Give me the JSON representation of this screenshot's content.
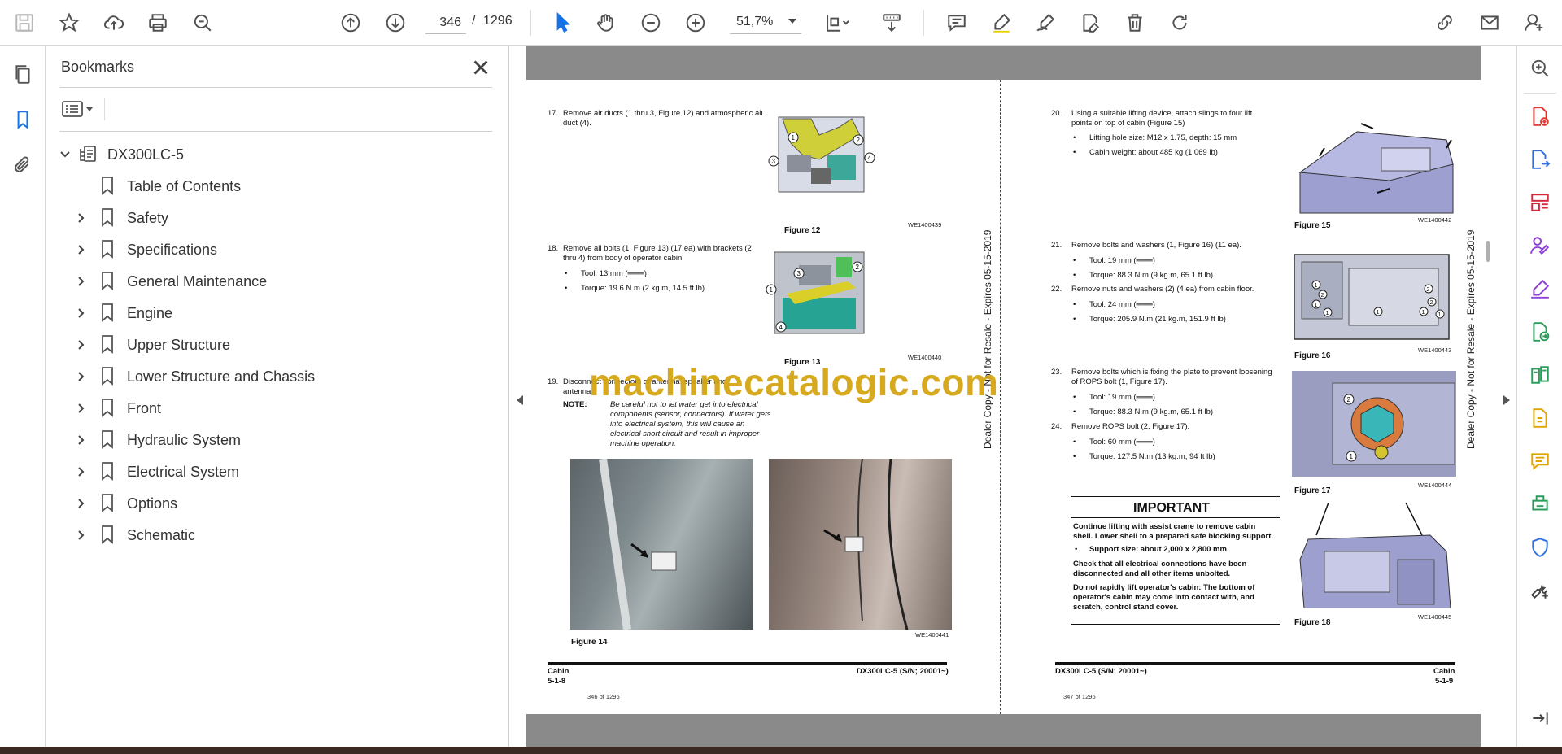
{
  "toolbar": {
    "page_current": "346",
    "page_separator": "/",
    "page_total": "1296",
    "zoom": "51,7%"
  },
  "bookmarks": {
    "title": "Bookmarks",
    "root": "DX300LC-5",
    "items": [
      {
        "label": "Table of Contents",
        "expandable": false
      },
      {
        "label": "Safety",
        "expandable": true
      },
      {
        "label": "Specifications",
        "expandable": true
      },
      {
        "label": "General Maintenance",
        "expandable": true
      },
      {
        "label": "Engine",
        "expandable": true
      },
      {
        "label": "Upper Structure",
        "expandable": true
      },
      {
        "label": "Lower Structure and Chassis",
        "expandable": true
      },
      {
        "label": "Front",
        "expandable": true
      },
      {
        "label": "Hydraulic System",
        "expandable": true
      },
      {
        "label": "Electrical System",
        "expandable": true
      },
      {
        "label": "Options",
        "expandable": true
      },
      {
        "label": "Schematic",
        "expandable": true
      }
    ]
  },
  "watermark": "machinecatalogic.com",
  "dealer_text": "Dealer Copy - Not for Resale - Expires 05-15-2019",
  "left_page": {
    "step17_num": "17.",
    "step17_l1": "Remove air ducts (1 thru 3, Figure 12) and atmospheric air",
    "step17_l2": "duct (4).",
    "fig12_cap": "Figure 12",
    "fig12_code": "WE1400439",
    "step18_num": "18.",
    "step18_l1": "Remove all bolts (1, Figure 13) (17 ea) with brackets (2",
    "step18_l2": "thru 4) from body of operator cabin.",
    "step18_tool": "Tool: 13 mm (═══)",
    "step18_torque": "Torque: 19.6 N.m (2 kg.m, 14.5 ft lb)",
    "fig13_cap": "Figure 13",
    "fig13_code": "WE1400440",
    "step19_num": "19.",
    "step19_l1": "Disconnect connectors of antenna, speaker and",
    "step19_l2": "antenna.",
    "note_label": "NOTE:",
    "note_l1": "Be careful not to let water get into electrical",
    "note_l2": "components (sensor, connectors). If water gets",
    "note_l3": "into electrical system, this will cause an",
    "note_l4": "electrical short circuit and result in improper",
    "note_l5": "machine operation.",
    "fig14_cap": "Figure 14",
    "fig14_code": "WE1400441",
    "footer_left1": "Cabin",
    "footer_left2": "5-1-8",
    "footer_right": "DX300LC-5 (S/N; 20001~)",
    "footer_pages": "346 of 1296"
  },
  "right_page": {
    "step20_num": "20.",
    "step20_l1": "Using a suitable lifting device, attach slings to four lift",
    "step20_l2": "points on top of cabin (Figure 15)",
    "step20_b1": "Lifting hole size: M12 x 1.75, depth: 15 mm",
    "step20_b2": "Cabin weight: about 485 kg (1,069 lb)",
    "fig15_cap": "Figure 15",
    "fig15_code": "WE1400442",
    "step21_num": "21.",
    "step21_l1": "Remove bolts and washers (1, Figure 16) (11 ea).",
    "step21_tool": "Tool: 19 mm (═══)",
    "step21_torque": "Torque: 88.3 N.m (9 kg.m, 65.1 ft lb)",
    "step22_num": "22.",
    "step22_l1": "Remove nuts and washers (2) (4 ea) from cabin floor.",
    "step22_tool": "Tool: 24 mm (═══)",
    "step22_torque": "Torque: 205.9 N.m (21 kg.m, 151.9 ft lb)",
    "fig16_cap": "Figure 16",
    "fig16_code": "WE1400443",
    "step23_num": "23.",
    "step23_l1": "Remove bolts which is fixing the plate to prevent loosening",
    "step23_l2": "of ROPS bolt (1, Figure 17).",
    "step23_tool": "Tool: 19 mm (═══)",
    "step23_torque": "Torque: 88.3 N.m (9 kg.m, 65.1 ft lb)",
    "step24_num": "24.",
    "step24_l1": "Remove ROPS bolt (2, Figure 17).",
    "step24_tool": "Tool: 60 mm (═══)",
    "step24_torque": "Torque: 127.5 N.m (13 kg.m, 94 ft lb)",
    "fig17_cap": "Figure 17",
    "fig17_code": "WE1400444",
    "important_title": "IMPORTANT",
    "imp_l1": "Continue lifting with assist crane to remove cabin",
    "imp_l2": "shell. Lower shell to a prepared safe blocking support.",
    "imp_b1": "Support size: about 2,000 x 2,800 mm",
    "imp_l3": "Check that all electrical connections have been",
    "imp_l4": "disconnected and all other items unbolted.",
    "imp_l5": "Do not rapidly lift operator's cabin: The bottom of",
    "imp_l6": "operator's cabin may come into contact with, and",
    "imp_l7": "scratch, control stand cover.",
    "fig18_cap": "Figure 18",
    "fig18_code": "WE1400445",
    "footer_left": "DX300LC-5 (S/N; 20001~)",
    "footer_right1": "Cabin",
    "footer_right2": "5-1-9",
    "footer_pages": "347 of 1296"
  }
}
